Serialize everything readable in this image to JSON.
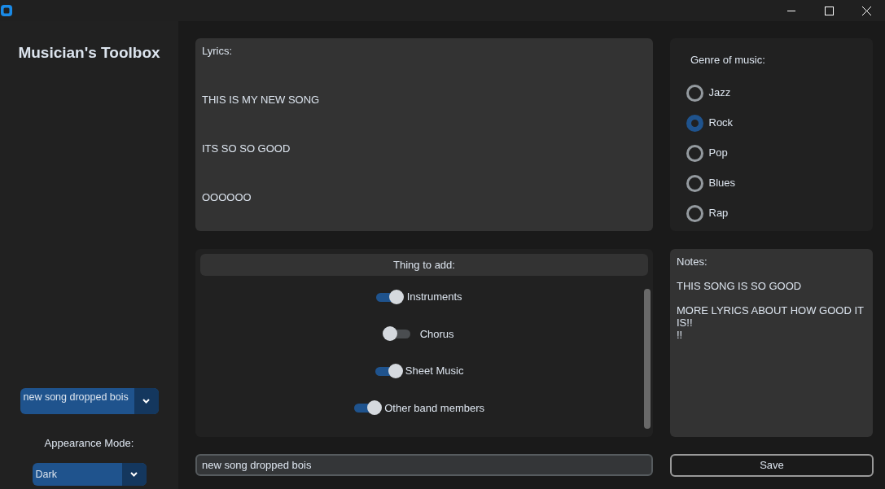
{
  "sidebar": {
    "title": "Musician's Toolbox",
    "song_menu": {
      "value": "new song dropped bois"
    },
    "appearance_label": "Appearance Mode:",
    "appearance_menu": {
      "value": "Dark"
    }
  },
  "lyrics": {
    "lines": [
      "Lyrics:",
      "THIS IS MY NEW SONG",
      "ITS SO SO GOOD",
      "OOOOOO"
    ]
  },
  "genre": {
    "label": "Genre of music:",
    "options": [
      {
        "label": "Jazz",
        "selected": false
      },
      {
        "label": "Rock",
        "selected": true
      },
      {
        "label": "Pop",
        "selected": false
      },
      {
        "label": "Blues",
        "selected": false
      },
      {
        "label": "Rap",
        "selected": false
      }
    ]
  },
  "things": {
    "header": "Thing to add:",
    "switches": [
      {
        "label": "Instruments",
        "on": true
      },
      {
        "label": "Chorus",
        "on": false
      },
      {
        "label": "Sheet Music",
        "on": true
      },
      {
        "label": "Other band members",
        "on": true
      }
    ]
  },
  "notes": {
    "lines": [
      "Notes:",
      "THIS SONG IS SO GOOD",
      "MORE LYRICS ABOUT HOW GOOD IT IS!!",
      "!!"
    ]
  },
  "name_field": {
    "value": "new song dropped bois"
  },
  "save_button": {
    "label": "Save"
  }
}
